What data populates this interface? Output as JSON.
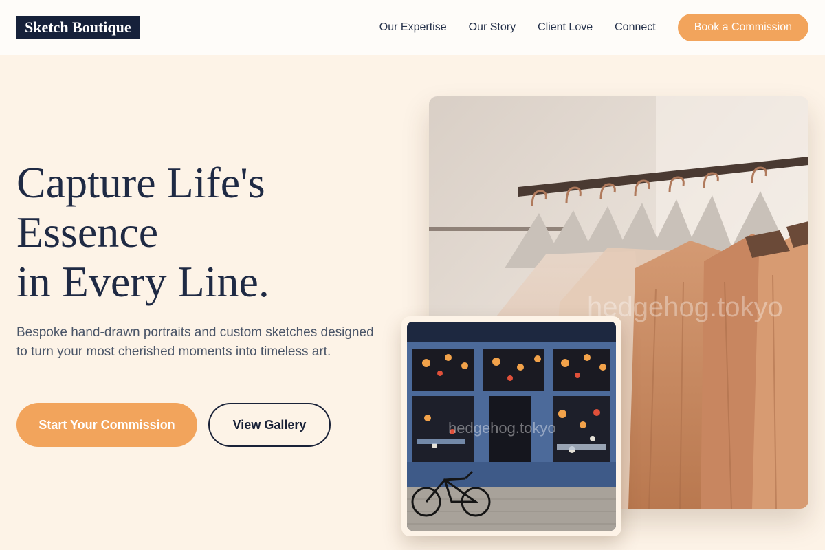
{
  "header": {
    "logo": "Sketch Boutique",
    "nav": [
      {
        "label": "Our Expertise"
      },
      {
        "label": "Our Story"
      },
      {
        "label": "Client Love"
      },
      {
        "label": "Connect"
      }
    ],
    "cta_label": "Book a Commission"
  },
  "hero": {
    "title_lines": [
      "Capture Life's",
      "Essence",
      "in Every Line."
    ],
    "subtitle": "Bespoke hand-drawn portraits and custom sketches designed to turn your most cherished moments into timeless art.",
    "primary_label": "Start Your Commission",
    "secondary_label": "View Gallery"
  },
  "images": {
    "main_watermark": "hedgehog.tokyo",
    "inset_watermark": "hedgehog.tokyo"
  },
  "colors": {
    "background": "#fdf3e7",
    "header_bg": "#fefcf9",
    "accent": "#f2a45c",
    "navy": "#16213a",
    "text": "#1f2a44"
  }
}
